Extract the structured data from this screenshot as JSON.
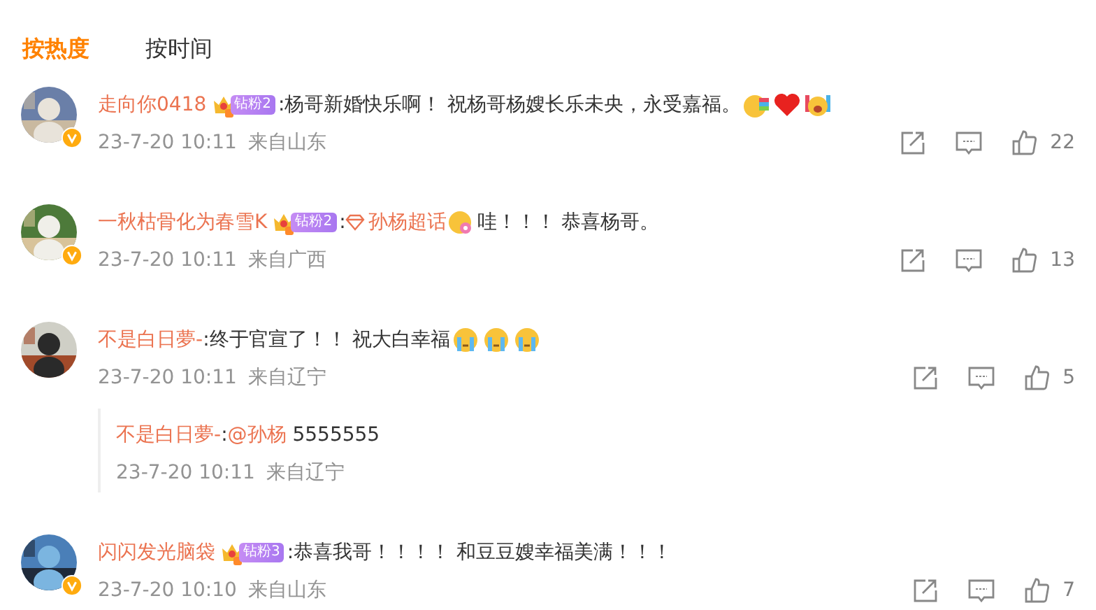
{
  "tabs": [
    {
      "label": "按热度",
      "selected": true
    },
    {
      "label": "按时间",
      "selected": false
    }
  ],
  "comments": [
    {
      "user": "走向你0418",
      "verified": true,
      "badge": "钻粉2",
      "segments": [
        {
          "kind": "text",
          "text": ":杨哥新婚快乐啊！ 祝杨哥杨嫂长乐未央，永受嘉福。"
        },
        {
          "kind": "rainbow"
        },
        {
          "kind": "heart"
        },
        {
          "kind": "cheer"
        }
      ],
      "time": "23-7-20 10:11",
      "location": "来自山东",
      "likes": "22"
    },
    {
      "user": "一秋枯骨化为春雪K",
      "verified": true,
      "badge": "钻粉2",
      "segments": [
        {
          "kind": "text",
          "text": ":"
        },
        {
          "kind": "topic",
          "text": "孙杨超话"
        },
        {
          "kind": "flower"
        },
        {
          "kind": "text",
          "text": "哇！！！ 恭喜杨哥。"
        }
      ],
      "time": "23-7-20 10:11",
      "location": "来自广西",
      "likes": "13"
    },
    {
      "user": "不是白日夢-",
      "verified": false,
      "segments": [
        {
          "kind": "text",
          "text": ":终于官宣了！！ 祝大白幸福"
        },
        {
          "kind": "cry"
        },
        {
          "kind": "cry"
        },
        {
          "kind": "cry"
        }
      ],
      "time": "23-7-20 10:11",
      "location": "来自辽宁",
      "likes": "5",
      "replies": [
        {
          "user": "不是白日夢-",
          "segments": [
            {
              "kind": "text",
              "text": ":"
            },
            {
              "kind": "mention",
              "text": "@孙杨"
            },
            {
              "kind": "text",
              "text": " 5555555"
            }
          ],
          "time": "23-7-20 10:11",
          "location": "来自辽宁"
        }
      ]
    },
    {
      "user": "闪闪发光脑袋",
      "verified": true,
      "badge": "钻粉3",
      "segments": [
        {
          "kind": "text",
          "text": ":恭喜我哥！！！！ 和豆豆嫂幸福美满！！！"
        }
      ],
      "time": "23-7-20 10:10",
      "location": "来自山东",
      "likes": "7"
    }
  ]
}
